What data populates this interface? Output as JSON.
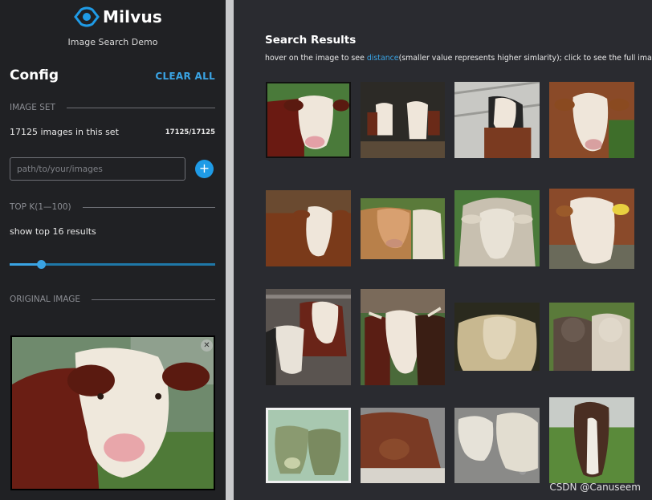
{
  "app": {
    "brand": "Milvus",
    "subtitle": "Image Search Demo",
    "brand_color": "#1f9be6"
  },
  "config": {
    "title": "Config",
    "clear_all": "CLEAR ALL",
    "image_set": {
      "heading": "IMAGE SET",
      "count_text": "17125 images in this set",
      "count_ratio": "17125/17125",
      "path_placeholder": "path/to/your/images",
      "add_icon": "plus-icon"
    },
    "topk": {
      "heading": "TOP K(1—100)",
      "summary": "show top 16 results",
      "value": 16,
      "min": 1,
      "max": 100
    },
    "original": {
      "heading": "ORIGINAL IMAGE",
      "close_icon": "close-icon"
    }
  },
  "results": {
    "title": "Search Results",
    "hint_before": "hover on the image to see ",
    "hint_link": "distance",
    "hint_after": "(smaller value represents higher simlarity); click to see the full image",
    "count": 16
  },
  "watermark": "CSDN @Canuseem"
}
